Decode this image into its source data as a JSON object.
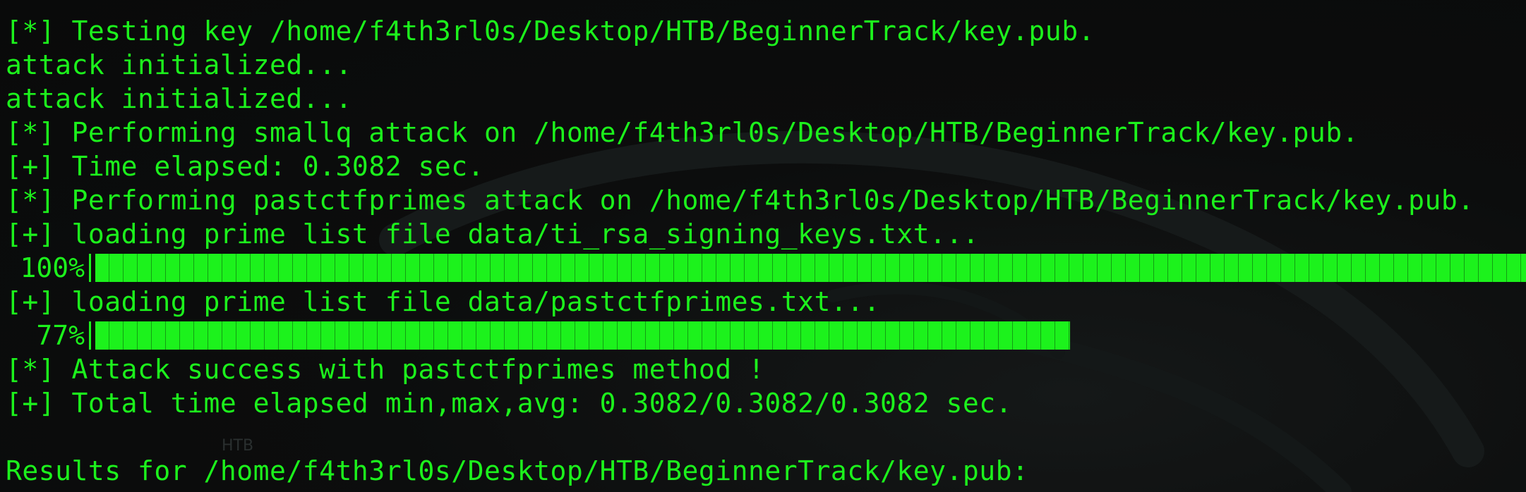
{
  "terminal": {
    "lines": [
      "[*] Testing key /home/f4th3rl0s/Desktop/HTB/BeginnerTrack/key.pub.",
      "attack initialized...",
      "attack initialized...",
      "[*] Performing smallq attack on /home/f4th3rl0s/Desktop/HTB/BeginnerTrack/key.pub.",
      "[+] Time elapsed: 0.3082 sec.",
      "[*] Performing pastctfprimes attack on /home/f4th3rl0s/Desktop/HTB/BeginnerTrack/key.pub.",
      "[+] loading prime list file data/ti_rsa_signing_keys.txt...",
      "[+] loading prime list file data/pastctfprimes.txt...",
      "[*] Attack success with pastctfprimes method !",
      "[+] Total time elapsed min,max,avg: 0.3082/0.3082/0.3082 sec.",
      "Results for /home/f4th3rl0s/Desktop/HTB/BeginnerTrack/key.pub:"
    ],
    "progress": [
      {
        "label": "100%",
        "fraction": 1.0
      },
      {
        "label": "77%",
        "fraction": 0.77
      }
    ]
  },
  "background_watermark": {
    "text_1": "HTB"
  },
  "colors": {
    "text": "#1cf21c",
    "background": "#0b0c0c"
  }
}
